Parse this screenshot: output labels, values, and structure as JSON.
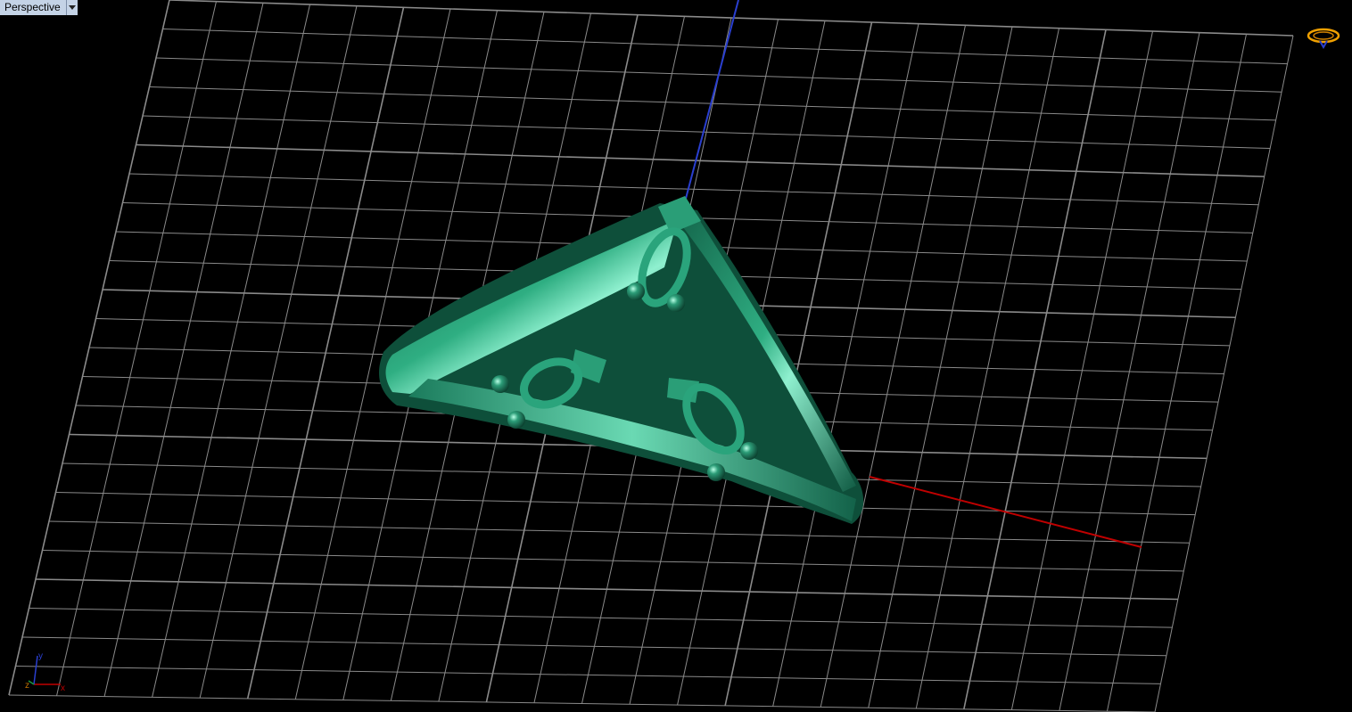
{
  "viewport": {
    "title": "Perspective",
    "menu_icon": "dropdown-arrow-icon",
    "cplane_icon": "construction-plane-ring-icon"
  },
  "axes_widget": {
    "x_label": "x",
    "y_label": "y",
    "z_label": "z"
  },
  "colors": {
    "background": "#000000",
    "grid": "#8a8a8a",
    "x_axis": "#c00000",
    "y_axis": "#2a3fd0",
    "model": "#1e8a66",
    "model_highlight": "#7fe0bf",
    "label_bg": "#c4d3e6"
  },
  "scene": {
    "object": "ring-model",
    "grid_visible": true
  }
}
